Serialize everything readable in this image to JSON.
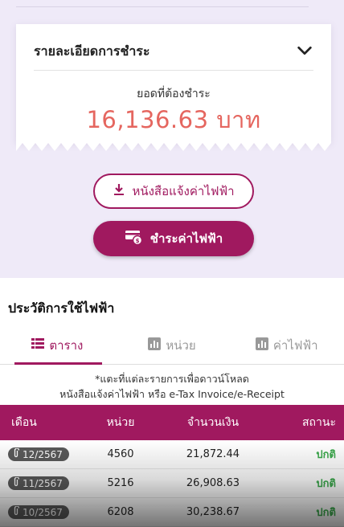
{
  "payment": {
    "title": "รายละเอียดการชำระ",
    "due_label": "ยอดที่ต้องชำระ",
    "due_amount": "16,136.63 บาท"
  },
  "buttons": {
    "invoice_label": "หนังสือแจ้งค่าไฟฟ้า",
    "pay_label": "ชำระค่าไฟฟ้า"
  },
  "history": {
    "title": "ประวัติการใช้ไฟฟ้า",
    "tabs": [
      {
        "label": "ตาราง",
        "icon": "table-icon",
        "active": true
      },
      {
        "label": "หน่วย",
        "icon": "bar-chart-icon",
        "active": false
      },
      {
        "label": "ค่าไฟฟ้า",
        "icon": "bar-chart-icon",
        "active": false
      }
    ],
    "note_line1": "*แตะที่แต่ละรายการเพื่อดาวน์โหลด",
    "note_line2": "หนังสือแจ้งค่าไฟฟ้า หรือ e-Tax Invoice/e-Receipt",
    "columns": {
      "month": "เดือน",
      "unit": "หน่วย",
      "amount": "จำนวนเงิน",
      "status": "สถานะ"
    },
    "rows": [
      {
        "month": "12/2567",
        "unit": "4560",
        "amount": "21,872.44",
        "status": "ปกติ"
      },
      {
        "month": "11/2567",
        "unit": "5216",
        "amount": "26,908.63",
        "status": "ปกติ"
      },
      {
        "month": "10/2567",
        "unit": "6208",
        "amount": "30,238.67",
        "status": "ปกติ"
      }
    ]
  },
  "colors": {
    "brand": "#a0195f",
    "amount": "#e5665f",
    "ok": "#39a84a"
  }
}
